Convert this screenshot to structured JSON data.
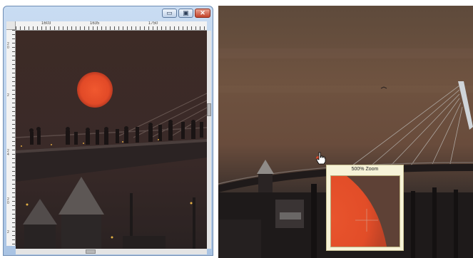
{
  "window": {
    "buttons": {
      "minimize_glyph": "▭",
      "maximize_glyph": "▣",
      "close_glyph": "✕"
    },
    "ruler_top_labels": [
      "1603",
      "1635",
      "1750"
    ],
    "ruler_left_labels": [
      "2 0",
      "2",
      "2 4",
      "2 0",
      "2"
    ],
    "canvas_description_icon": "photo-canvas"
  },
  "zoom_popup": {
    "label": "500% Zoom"
  },
  "cursor": {
    "icon": "hand-pointer-icon"
  },
  "colors": {
    "sun": "#e8502e",
    "sky": "#3d2b26",
    "title_gradient": "#a9c3e3",
    "zoom_bg": "#f7f3d8"
  }
}
